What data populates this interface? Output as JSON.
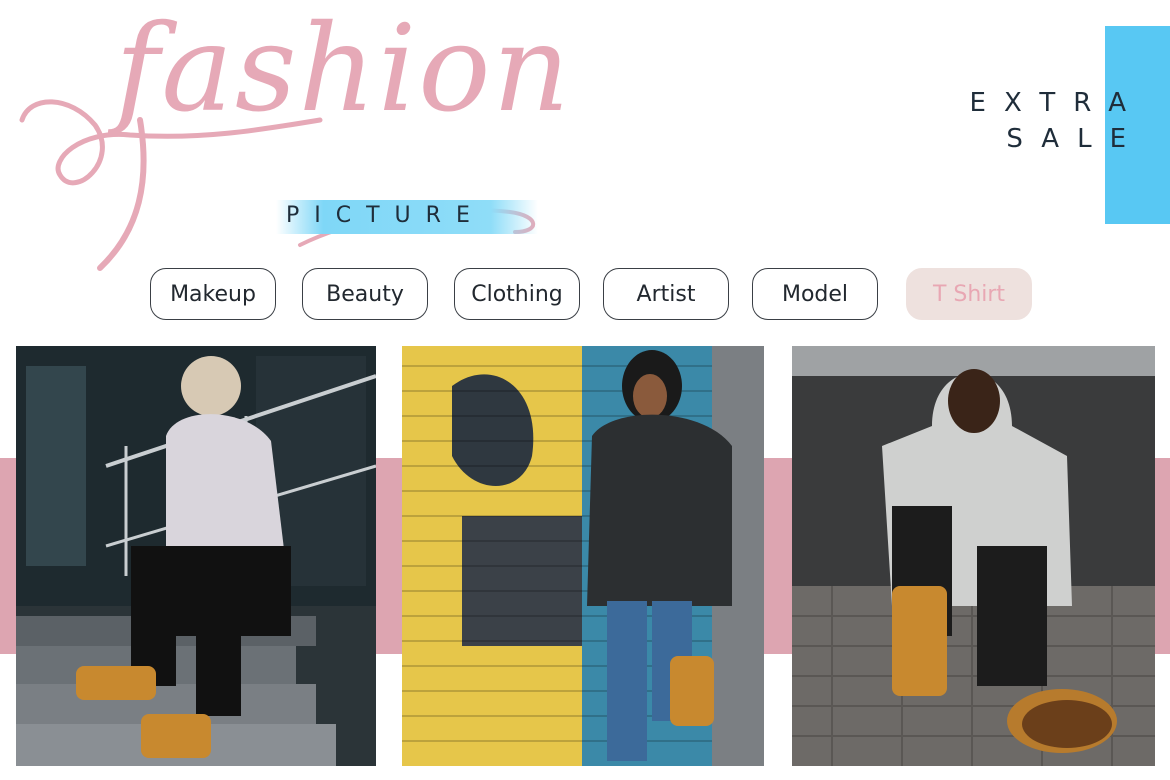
{
  "brand": {
    "script_title": "fashion",
    "subtitle": "PICTURE"
  },
  "promo": {
    "line1": "EXTRA",
    "line2": "SALE"
  },
  "tags": [
    "Makeup",
    "Beauty",
    "Clothing",
    "Artist",
    "Model",
    "T Shirt"
  ],
  "active_tag": "T Shirt",
  "colors": {
    "pink": "#e6a9b7",
    "band_pink": "#dda5b1",
    "blue": "#58c8f3",
    "dark_text": "#1f2d3a",
    "active_tag_bg": "#eee1de"
  }
}
